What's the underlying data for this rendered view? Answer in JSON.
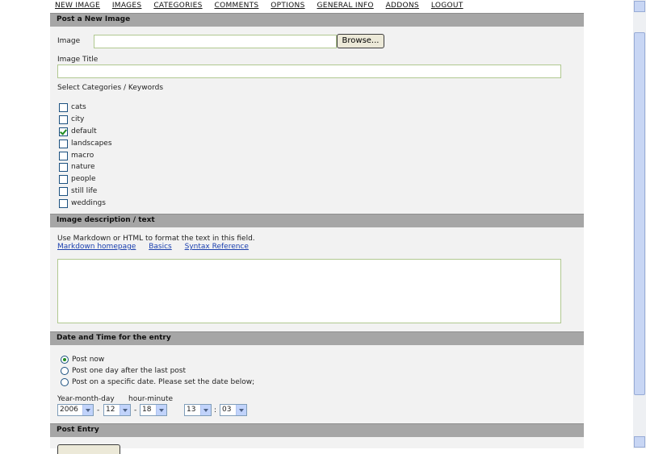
{
  "nav": {
    "items": [
      "NEW IMAGE",
      "IMAGES",
      "CATEGORIES",
      "COMMENTS",
      "OPTIONS",
      "GENERAL INFO",
      "ADDONS",
      "LOGOUT"
    ]
  },
  "post_image": {
    "header": "Post a New Image",
    "image_label": "Image",
    "browse_label": "Browse...",
    "title_label": "Image Title",
    "categories_label": "Select Categories / Keywords",
    "categories": [
      {
        "label": "cats",
        "checked": false
      },
      {
        "label": "city",
        "checked": false
      },
      {
        "label": "default",
        "checked": true
      },
      {
        "label": "landscapes",
        "checked": false
      },
      {
        "label": "macro",
        "checked": false
      },
      {
        "label": "nature",
        "checked": false
      },
      {
        "label": "people",
        "checked": false
      },
      {
        "label": "still life",
        "checked": false
      },
      {
        "label": "weddings",
        "checked": false
      }
    ]
  },
  "description": {
    "header": "Image description / text",
    "hint": "Use Markdown or HTML to format the text in this field.",
    "links": [
      "Markdown homepage",
      "Basics",
      "Syntax Reference"
    ]
  },
  "datetime": {
    "header": "Date and Time for the entry",
    "options": [
      {
        "label": "Post now",
        "checked": true
      },
      {
        "label": "Post one day after the last post",
        "checked": false
      },
      {
        "label": "Post on a specific date. Please set the date below;",
        "checked": false
      }
    ],
    "ymd_label": "Year-month-day",
    "hm_label": "hour-minute",
    "year": "2006",
    "month": "12",
    "day": "18",
    "hour": "13",
    "minute": "03",
    "sep_dash": "-",
    "sep_colon": ":"
  },
  "post_entry": {
    "header": "Post Entry"
  }
}
